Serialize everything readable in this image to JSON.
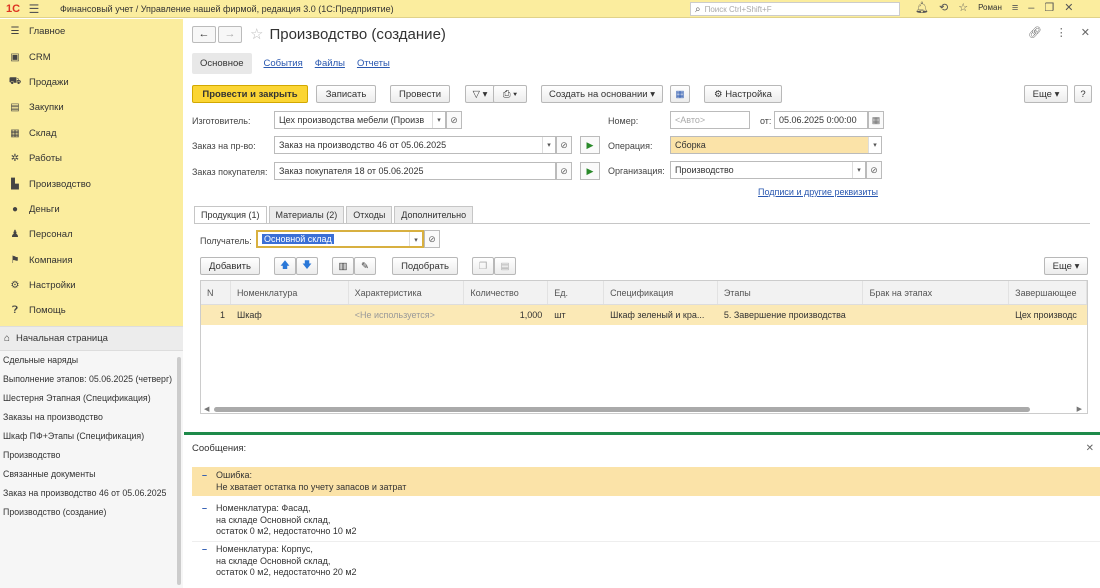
{
  "titlebar": {
    "logo": "1С",
    "title": "Финансовый учет / Управление нашей фирмой, редакция 3.0  (1С:Предприятие)",
    "search_placeholder": "Поиск Ctrl+Shift+F",
    "user": "Роман"
  },
  "sidebar": {
    "items": [
      {
        "label": "Главное",
        "icon": "menu-icon"
      },
      {
        "label": "CRM",
        "icon": "crm-icon"
      },
      {
        "label": "Продажи",
        "icon": "sales-icon"
      },
      {
        "label": "Закупки",
        "icon": "purchases-icon"
      },
      {
        "label": "Склад",
        "icon": "warehouse-icon"
      },
      {
        "label": "Работы",
        "icon": "works-icon"
      },
      {
        "label": "Производство",
        "icon": "production-icon"
      },
      {
        "label": "Деньги",
        "icon": "money-icon"
      },
      {
        "label": "Персонал",
        "icon": "personnel-icon"
      },
      {
        "label": "Компания",
        "icon": "company-icon"
      },
      {
        "label": "Настройки",
        "icon": "settings-icon"
      },
      {
        "label": "Помощь",
        "icon": "help-icon"
      }
    ]
  },
  "nav_panel": {
    "home": "Начальная страница",
    "items": [
      "Сдельные наряды",
      "Выполнение этапов: 05.06.2025 (четверг)",
      "Шестерня Этапная (Спецификация)",
      "Заказы на производство",
      "Шкаф ПФ+Этапы (Спецификация)",
      "Производство",
      "Связанные документы",
      "Заказ на производство 46 от 05.06.2025",
      "Производство (создание)"
    ]
  },
  "doc": {
    "title": "Производство (создание)",
    "tabs": [
      "Основное",
      "События",
      "Файлы",
      "Отчеты"
    ],
    "toolbar": {
      "post_close": "Провести и закрыть",
      "save": "Записать",
      "post": "Провести",
      "create_based": "Создать на основании",
      "settings": "Настройка",
      "more": "Еще"
    },
    "fields": {
      "manufacturer_label": "Изготовитель:",
      "manufacturer_value": "Цех производства мебели (Произв",
      "order_label": "Заказ на пр-во:",
      "order_value": "Заказ на производство 46 от 05.06.2025",
      "customer_order_label": "Заказ покупателя:",
      "customer_order_value": "Заказ покупателя 18 от 05.06.2025",
      "number_label": "Номер:",
      "number_placeholder": "<Авто>",
      "date_label": "от:",
      "date_value": "05.06.2025  0:00:00",
      "operation_label": "Операция:",
      "operation_value": "Сборка",
      "org_label": "Организация:",
      "org_value": "Производство",
      "signatures_link": "Подписи и другие реквизиты"
    },
    "inner_tabs": [
      "Продукция (1)",
      "Материалы (2)",
      "Отходы",
      "Дополнительно"
    ],
    "recipient_label": "Получатель:",
    "recipient_value": "Основной склад",
    "table_toolbar": {
      "add": "Добавить",
      "pick": "Подобрать",
      "more": "Еще"
    },
    "table": {
      "columns": [
        "N",
        "Номенклатура",
        "Характеристика",
        "Количество",
        "Ед.",
        "Спецификация",
        "Этапы",
        "Брак на этапах",
        "Завершающее"
      ],
      "rows": [
        [
          "1",
          "Шкаф",
          "<Не используется>",
          "1,000",
          "шт",
          "Шкаф зеленый и кра...",
          "5. Завершение производства",
          "",
          "Цех производс"
        ]
      ]
    },
    "messages": {
      "title": "Сообщения:",
      "items": [
        {
          "line1": "Ошибка:",
          "line2": "Не хватает остатка по учету запасов и затрат",
          "line3": ""
        },
        {
          "line1": "Номенклатура: Фасад,",
          "line2": "на складе Основной склад,",
          "line3": "остаток 0 м2, недостаточно 10 м2"
        },
        {
          "line1": "Номенклатура: Корпус,",
          "line2": "на складе Основной склад,",
          "line3": "остаток 0 м2, недостаточно 20 м2"
        }
      ]
    }
  }
}
